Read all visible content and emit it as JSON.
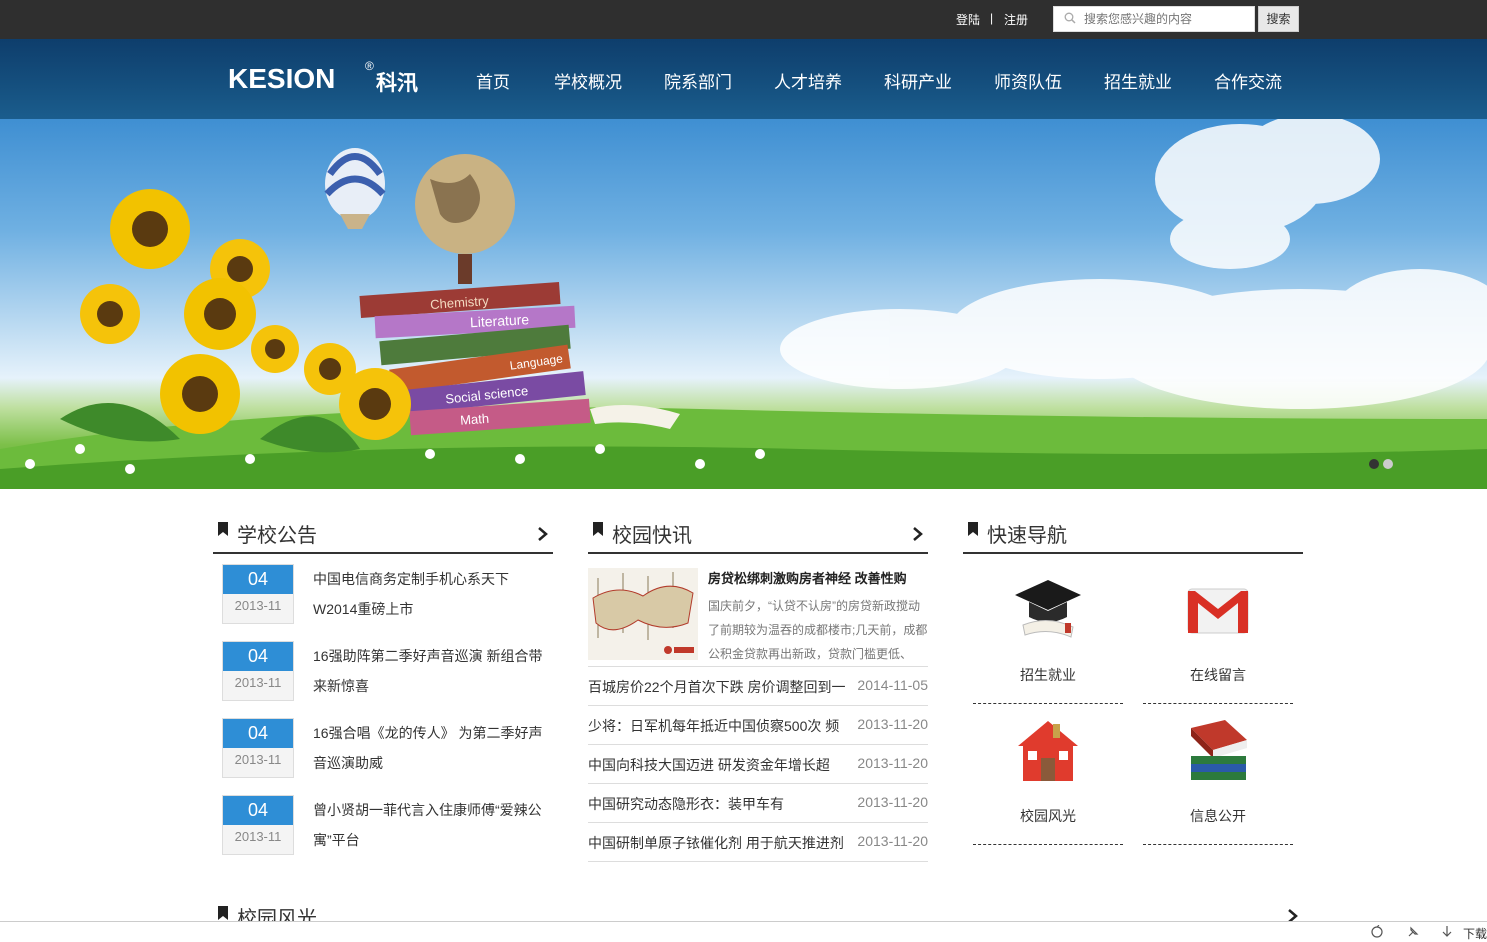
{
  "topbar": {
    "login": "登陆",
    "separator": "|",
    "register": "注册",
    "search_placeholder": "搜索您感兴趣的内容",
    "search_button": "搜索"
  },
  "brand": {
    "logo_text": "KESION",
    "logo_cn": "科汛",
    "logo_mark": "®"
  },
  "nav": [
    "首页",
    "学校概况",
    "院系部门",
    "人才培养",
    "科研产业",
    "师资队伍",
    "招生就业",
    "合作交流"
  ],
  "banner": {
    "book_labels": [
      "Chemistry",
      "Literature",
      "Language",
      "Social science",
      "Math"
    ],
    "slides": 2,
    "active_slide": 1
  },
  "notices": {
    "title": "学校公告",
    "items": [
      {
        "day": "04",
        "ym": "2013-11",
        "text": "中国电信商务定制手机心系天下W2014重磅上市"
      },
      {
        "day": "04",
        "ym": "2013-11",
        "text": "16强助阵第二季好声音巡演 新组合带来新惊喜"
      },
      {
        "day": "04",
        "ym": "2013-11",
        "text": "16强合唱《龙的传人》 为第二季好声音巡演助威"
      },
      {
        "day": "04",
        "ym": "2013-11",
        "text": "曾小贤胡一菲代言入住康师傅“爱辣公寓”平台"
      }
    ]
  },
  "news": {
    "title": "校园快讯",
    "feature": {
      "title": "房贷松绑刺激购房者神经 改善性购",
      "desc": "国庆前夕，“认贷不认房”的房贷新政搅动了前期较为温吞的成都楼市;几天前，成都公积金贷款再出新政，贷款门槛更低、"
    },
    "items": [
      {
        "text": "百城房价22个月首次下跌 房价调整回到一",
        "date": "2014-11-05"
      },
      {
        "text": "少将：日军机每年抵近中国侦察500次 频",
        "date": "2013-11-20"
      },
      {
        "text": "中国向科技大国迈进 研发资金年增长超",
        "date": "2013-11-20"
      },
      {
        "text": "中国研究动态隐形衣：装甲车有",
        "date": "2013-11-20"
      },
      {
        "text": "中国研制单原子铱催化剂 用于航天推进剂",
        "date": "2013-11-20"
      }
    ]
  },
  "quicknav": {
    "title": "快速导航",
    "items": [
      {
        "label": "招生就业",
        "icon": "graduation-cap-icon"
      },
      {
        "label": "在线留言",
        "icon": "mail-icon"
      },
      {
        "label": "校园风光",
        "icon": "house-icon"
      },
      {
        "label": "信息公开",
        "icon": "books-icon"
      }
    ]
  },
  "campus": {
    "title": "校园风光"
  },
  "statusbar": {
    "download": "下载"
  },
  "colors": {
    "topbar": "#2f2f2f",
    "nav": "#15507f",
    "accent": "#2e8ed6"
  }
}
